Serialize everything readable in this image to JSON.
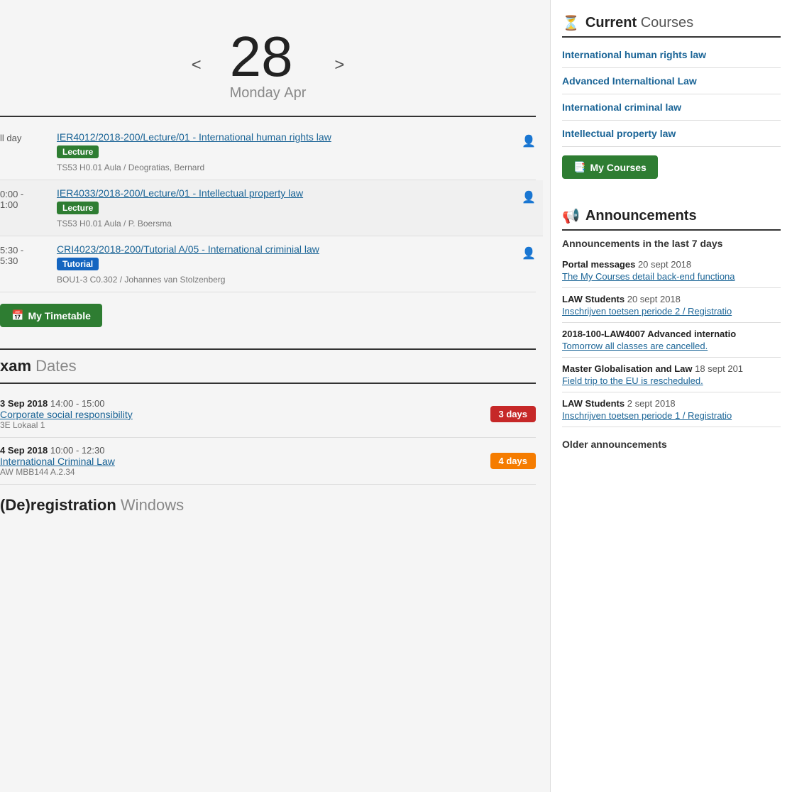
{
  "calendar": {
    "day_number": "28",
    "day_name": "Monday",
    "month": "Apr",
    "prev_label": "<",
    "next_label": ">"
  },
  "schedule": {
    "items": [
      {
        "time": "ll day",
        "link": "IER4012/2018-200/Lecture/01 - International human rights law",
        "badge": "Lecture",
        "badge_type": "lecture",
        "meta": "TS53 H0.01 Aula / Deogratias, Bernard",
        "highlighted": false
      },
      {
        "time": "0:00 - 1:00",
        "link": "IER4033/2018-200/Lecture/01 - Intellectual property law",
        "badge": "Lecture",
        "badge_type": "lecture",
        "meta": "TS53 H0.01 Aula / P. Boersma",
        "highlighted": true
      },
      {
        "time": "5:30 - 5:30",
        "link": "CRI4023/2018-200/Tutorial A/05 - International criminial law",
        "badge": "Tutorial",
        "badge_type": "tutorial",
        "meta": "BOU1-3 C0.302 / Johannes van Stolzenberg",
        "highlighted": false
      }
    ],
    "timetable_btn": "My Timetable"
  },
  "exam_dates": {
    "title_bold": "xam",
    "title_light": "Dates",
    "items": [
      {
        "date_bold": "3 Sep 2018",
        "time": "14:00 - 15:00",
        "course_link": "Corporate social responsibility",
        "location": "3E Lokaal 1",
        "days_label": "3 days",
        "days_type": "red"
      },
      {
        "date_bold": "4 Sep 2018",
        "time": "10:00 - 12:30",
        "course_link": "International Criminal Law",
        "location": "AW MBB144 A.2.34",
        "days_label": "4 days",
        "days_type": "orange"
      }
    ]
  },
  "registration": {
    "title_bold": "De)registration",
    "title_light": "Windows"
  },
  "sidebar": {
    "current_courses": {
      "header_bold": "Current",
      "header_light": "Courses",
      "courses": [
        {
          "label": "International human rights law"
        },
        {
          "label": "Advanced Internaltional Law"
        },
        {
          "label": "International criminal law"
        },
        {
          "label": "Intellectual property law"
        }
      ],
      "my_courses_btn": "My Courses"
    },
    "announcements": {
      "header": "Announcements",
      "subtitle": "Announcements in the last 7 days",
      "items": [
        {
          "source_bold": "Portal messages",
          "date": "20 sept 2018",
          "link": "The My Courses detail back-end functiona"
        },
        {
          "source_bold": "LAW Students",
          "date": "20 sept 2018",
          "link": "Inschrijven toetsen periode 2 / Registratio"
        },
        {
          "source_bold": "2018-100-LAW4007 Advanced internatio",
          "date": "",
          "link": "Tomorrow all classes are cancelled."
        },
        {
          "source_bold": "Master Globalisation and Law",
          "date": "18 sept 201",
          "link": "Field trip to the EU is rescheduled."
        },
        {
          "source_bold": "LAW Students",
          "date": "2 sept 2018",
          "link": "Inschrijven toetsen periode 1 / Registratio"
        }
      ],
      "older_label": "Older announcements"
    }
  }
}
